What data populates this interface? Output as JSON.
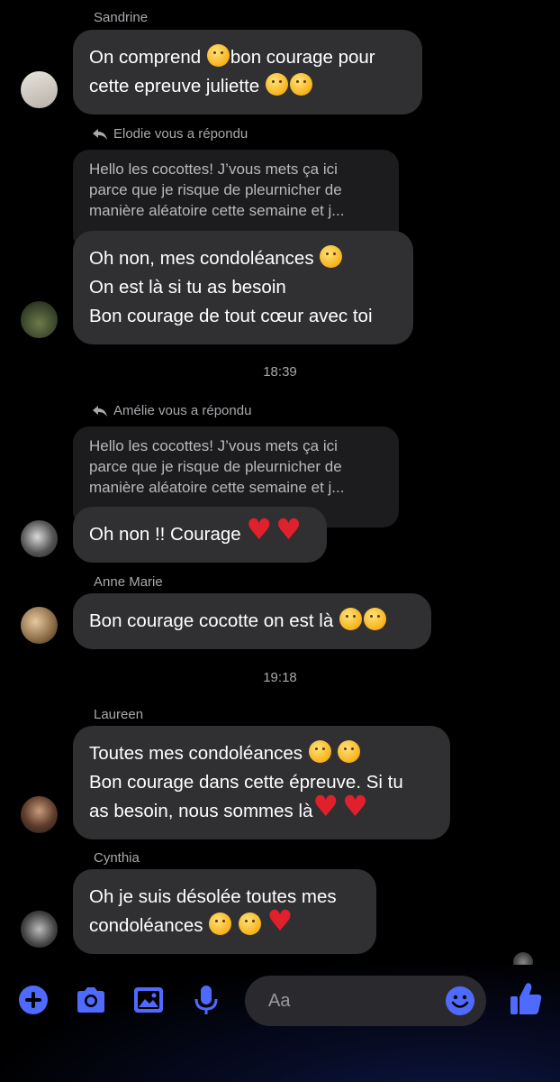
{
  "messages": {
    "sandrine": {
      "sender": "Sandrine",
      "line1a": "On comprend ",
      "line1b": "bon courage pour",
      "line2": "cette epreuve juliette"
    },
    "elodie": {
      "reply_note": "Elodie vous a répondu",
      "quote": "Hello les cocottes! J’vous mets ça ici\nparce que je risque de pleurnicher de\nmanière aléatoire cette semaine et j...",
      "line1": "Oh non, mes condoléances ",
      "line2": "On est là si tu as besoin",
      "line3": "Bon courage de tout cœur avec toi"
    },
    "time1": "18:39",
    "amelie": {
      "reply_note": "Amélie vous a répondu",
      "quote": "Hello les cocottes! J’vous mets ça ici\nparce que je risque de pleurnicher de\nmanière aléatoire cette semaine et j...",
      "line1": "Oh non !! Courage "
    },
    "anne_marie": {
      "sender": "Anne Marie",
      "line1": "Bon courage cocotte on est là "
    },
    "time2": "19:18",
    "laureen": {
      "sender": "Laureen",
      "line1": "Toutes mes condoléances ",
      "line2": "Bon courage dans cette épreuve. Si tu",
      "line3": "as besoin, nous sommes là"
    },
    "cynthia": {
      "sender": "Cynthia",
      "line1": "Oh je suis désolée toutes mes",
      "line2": "condoléances "
    }
  },
  "composer": {
    "placeholder": "Aa",
    "icons": [
      "plus-icon",
      "camera-icon",
      "image-icon",
      "microphone-icon",
      "emoji-icon",
      "thumbs-up-icon"
    ]
  },
  "colors": {
    "accent": "#4f6bff",
    "bubble": "#303033",
    "quote_bubble": "#1c1c1e",
    "background": "#000000",
    "meta_text": "#a8a8ad"
  }
}
